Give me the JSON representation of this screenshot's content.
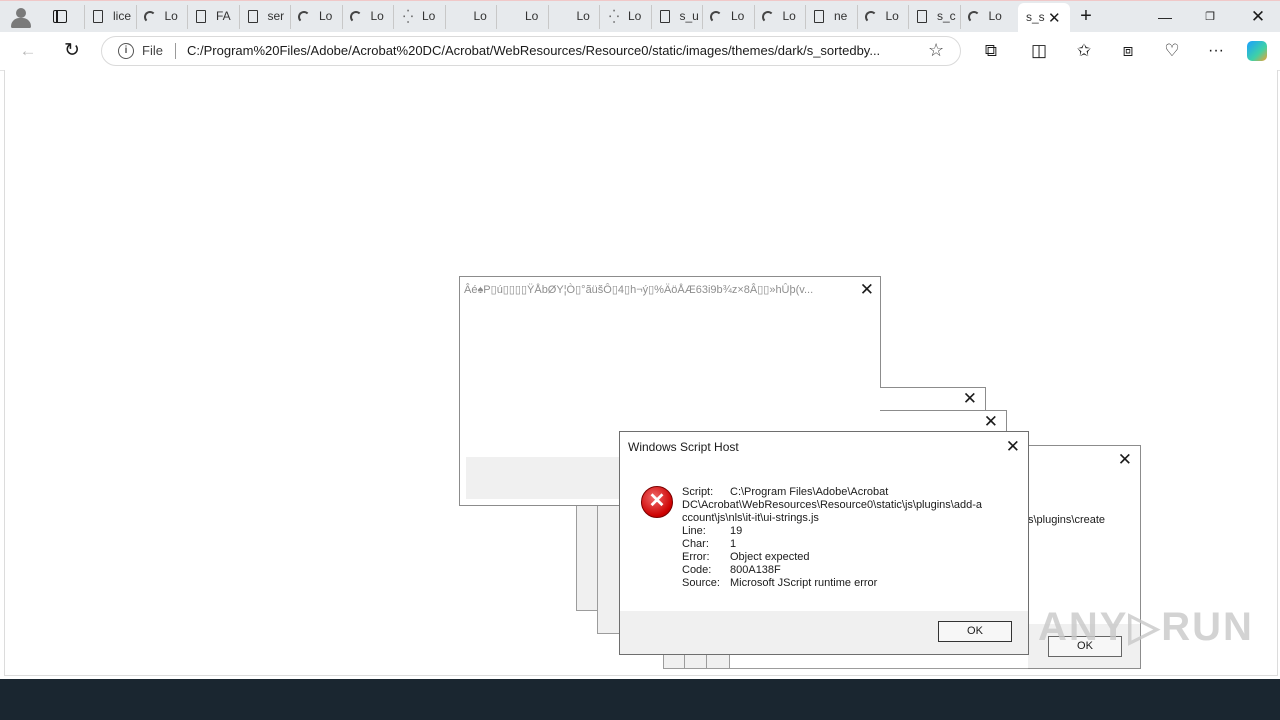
{
  "tabs": [
    {
      "label": "lice",
      "icon": "doc"
    },
    {
      "label": "Lo",
      "icon": "spin"
    },
    {
      "label": "FA",
      "icon": "doc"
    },
    {
      "label": "ser",
      "icon": "doc"
    },
    {
      "label": "Lo",
      "icon": "spin"
    },
    {
      "label": "Lo",
      "icon": "spin"
    },
    {
      "label": "Lo",
      "icon": "dots"
    },
    {
      "label": "Lo",
      "icon": "blank"
    },
    {
      "label": "Lo",
      "icon": "blank"
    },
    {
      "label": "Lo",
      "icon": "blank"
    },
    {
      "label": "Lo",
      "icon": "dots"
    },
    {
      "label": "s_u",
      "icon": "doc"
    },
    {
      "label": "Lo",
      "icon": "spin"
    },
    {
      "label": "Lo",
      "icon": "spin"
    },
    {
      "label": "ne",
      "icon": "doc"
    },
    {
      "label": "Lo",
      "icon": "spin"
    },
    {
      "label": "s_c",
      "icon": "doc"
    },
    {
      "label": "Lo",
      "icon": "spin"
    }
  ],
  "active_tab": {
    "label": "s_s"
  },
  "address_bar": {
    "scheme": "File",
    "url": "C:/Program%20Files/Adobe/Acrobat%20DC/Acrobat/WebResources/Resource0/static/images/themes/dark/s_sortedby..."
  },
  "dialog_garbled": {
    "title": "Âé♠P▯ú▯▯▯▯ŸÅbØY¦Ò▯°ãüš̌Ô▯4▯h¬ý▯%ÄöÅÆ63i9b¾z×8Â▯▯»hÛþ(v..."
  },
  "dialog_right": {
    "fragment": "s\\plugins\\create",
    "ok_label": "OK"
  },
  "error_dialog": {
    "title": "Windows Script Host",
    "rows": [
      {
        "key": "Script:",
        "value": "C:\\Program Files\\Adobe\\Acrobat"
      },
      {
        "key": "",
        "value": ""
      },
      {
        "key": "",
        "value": ""
      },
      {
        "key": "Line:",
        "value": "19"
      },
      {
        "key": "Char:",
        "value": "1"
      },
      {
        "key": "Error:",
        "value": "Object expected"
      },
      {
        "key": "Code:",
        "value": "800A138F"
      },
      {
        "key": "Source:",
        "value": "Microsoft JScript runtime error"
      }
    ],
    "script_line2": "DC\\Acrobat\\WebResources\\Resource0\\static\\js\\plugins\\add-a",
    "script_line3": "ccount\\js\\nls\\it-it\\ui-strings.js",
    "ok_label": "OK"
  },
  "watermark": "ANY▷RUN"
}
